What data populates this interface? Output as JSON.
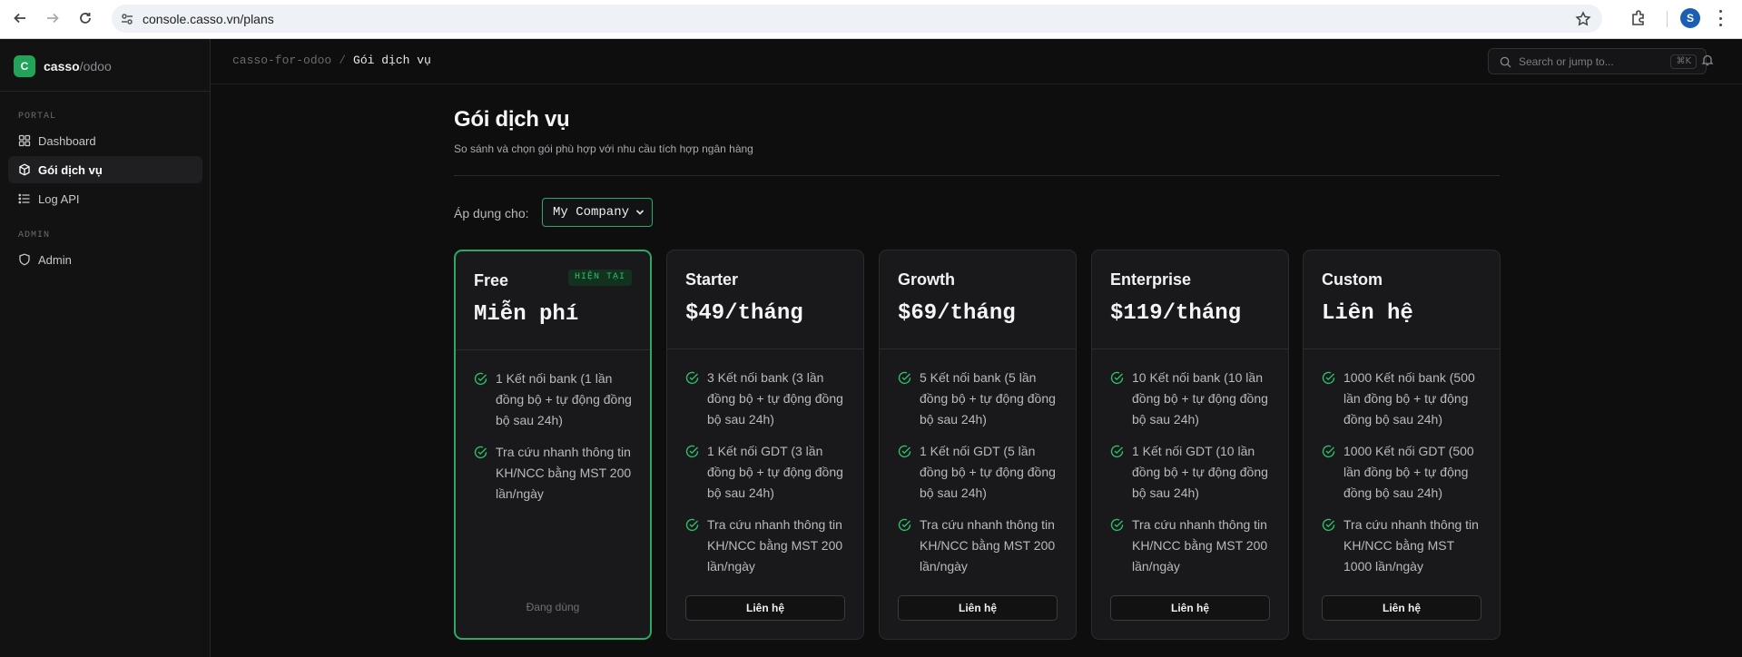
{
  "browser": {
    "url": "console.casso.vn/plans",
    "profile_initial": "S"
  },
  "brand": {
    "logo_letter": "C",
    "name": "casso",
    "suffix": "/odoo"
  },
  "sidebar": {
    "sections": [
      {
        "title": "PORTAL"
      },
      {
        "title": "ADMIN"
      }
    ],
    "items": [
      {
        "label": "Dashboard",
        "icon": "grid-icon",
        "active": false
      },
      {
        "label": "Gói dịch vụ",
        "icon": "box-icon",
        "active": true
      },
      {
        "label": "Log API",
        "icon": "list-icon",
        "active": false
      },
      {
        "label": "Admin",
        "icon": "shield-icon",
        "active": false
      }
    ]
  },
  "topbar": {
    "breadcrumb_root": "casso-for-odoo",
    "breadcrumb_separator": "/",
    "breadcrumb_current": "Gói dịch vụ",
    "search_placeholder": "Search or jump to...",
    "search_shortcut": "⌘K"
  },
  "main": {
    "title": "Gói dịch vụ",
    "subtitle": "So sánh và chọn gói phù hợp với nhu cầu tích hợp ngân hàng",
    "apply_label": "Áp dụng cho:",
    "company_selected": "My Company"
  },
  "plans": [
    {
      "name": "Free",
      "price": "Miễn phí",
      "badge": "HIỆN TẠI",
      "features": [
        "1 Kết nối bank (1 lần đồng bộ + tự động đồng bộ sau 24h)",
        "Tra cứu nhanh thông tin KH/NCC bằng MST 200 lần/ngày"
      ],
      "status": "Đang dùng"
    },
    {
      "name": "Starter",
      "price": "$49/tháng",
      "features": [
        "3 Kết nối bank (3 lần đồng bộ + tự động đồng bộ sau 24h)",
        "1 Kết nối GDT (3 lần đồng bộ + tự động đồng bộ sau 24h)",
        "Tra cứu nhanh thông tin KH/NCC bằng MST 200 lần/ngày"
      ],
      "cta": "Liên hệ"
    },
    {
      "name": "Growth",
      "price": "$69/tháng",
      "features": [
        "5 Kết nối bank (5 lần đồng bộ + tự động đồng bộ sau 24h)",
        "1 Kết nối GDT (5 lần đồng bộ + tự động đồng bộ sau 24h)",
        "Tra cứu nhanh thông tin KH/NCC bằng MST 200 lần/ngày"
      ],
      "cta": "Liên hệ"
    },
    {
      "name": "Enterprise",
      "price": "$119/tháng",
      "features": [
        "10 Kết nối bank (10 lần đồng bộ + tự động đồng bộ sau 24h)",
        "1 Kết nối GDT (10 lần đồng bộ + tự động đồng bộ sau 24h)",
        "Tra cứu nhanh thông tin KH/NCC bằng MST 200 lần/ngày"
      ],
      "cta": "Liên hệ"
    },
    {
      "name": "Custom",
      "price": "Liên hệ",
      "features": [
        "1000 Kết nối bank (500 lần đồng bộ + tự động đồng bộ sau 24h)",
        "1000 Kết nối GDT (500 lần đồng bộ + tự động đồng bộ sau 24h)",
        "Tra cứu nhanh thông tin KH/NCC bằng MST 1000 lần/ngày"
      ],
      "cta": "Liên hệ"
    }
  ],
  "colors": {
    "accent": "#2da866",
    "background": "#0e0e0f",
    "card": "#19191b"
  }
}
